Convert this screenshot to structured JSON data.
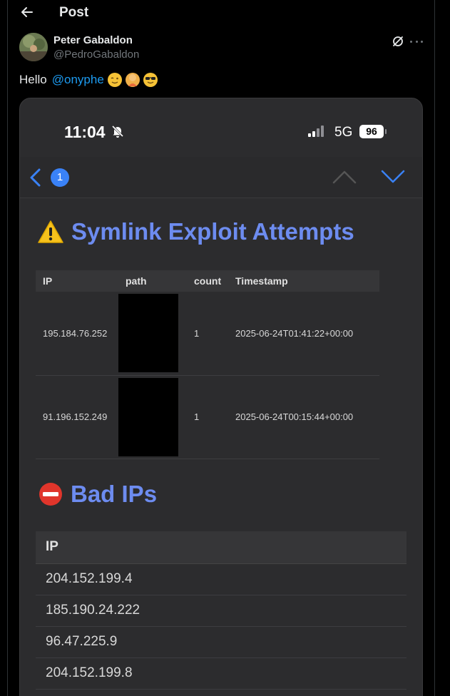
{
  "header": {
    "title": "Post"
  },
  "author": {
    "name": "Peter Gabaldon",
    "handle": "@PedroGabaldon"
  },
  "tweet": {
    "greeting": "Hello",
    "mention": "@onyphe",
    "emojis": [
      "winking-face",
      "woman-gesturing",
      "smiling-face-with-sunglasses"
    ]
  },
  "screenshot": {
    "status_bar": {
      "time": "11:04",
      "network": "5G",
      "battery": "96"
    },
    "nav": {
      "badge": "1"
    },
    "symlink_section": {
      "title": "Symlink Exploit Attempts",
      "columns": [
        "IP",
        "path",
        "count",
        "Timestamp"
      ],
      "rows": [
        {
          "ip": "195.184.76.252",
          "path": "",
          "count": "1",
          "timestamp": "2025-06-24T01:41:22+00:00"
        },
        {
          "ip": "91.196.152.249",
          "path": "",
          "count": "1",
          "timestamp": "2025-06-24T00:15:44+00:00"
        }
      ]
    },
    "bad_ips_section": {
      "title": "Bad IPs",
      "column": "IP",
      "rows": [
        "204.152.199.4",
        "185.190.24.222",
        "96.47.225.9",
        "204.152.199.8"
      ]
    }
  },
  "colors": {
    "accent": "#1d9bf0",
    "heading": "#6d8cf0",
    "badge": "#3a82f7"
  }
}
